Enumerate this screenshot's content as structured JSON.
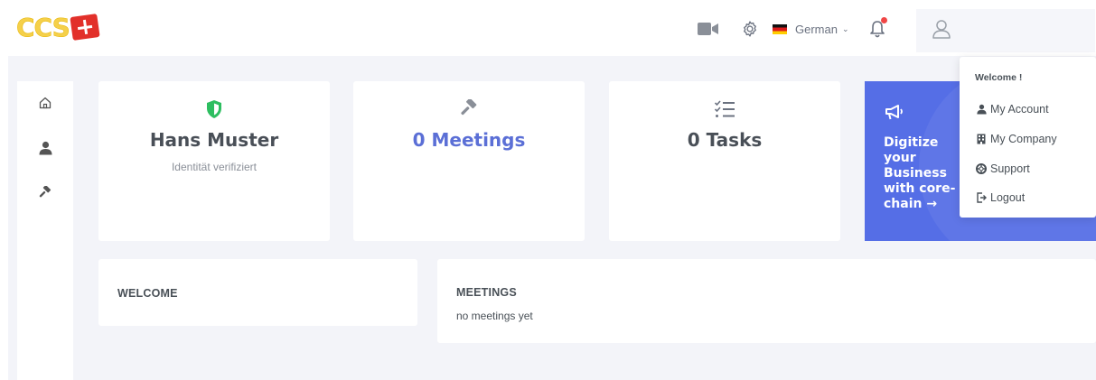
{
  "logo": {
    "text": "CCS"
  },
  "header": {
    "icons": [
      "video-icon",
      "gear-icon",
      "bell-icon",
      "user-icon"
    ],
    "language": {
      "label": "German",
      "flag": "de"
    }
  },
  "sidebar": {
    "items": [
      {
        "icon": "home-icon"
      },
      {
        "icon": "user-icon"
      },
      {
        "icon": "gavel-icon"
      }
    ]
  },
  "stats": [
    {
      "title": "Hans Muster",
      "subtitle": "Identität verifiziert",
      "icon": "shield-check-icon",
      "icon_color": "#2dbe60"
    },
    {
      "title": "0 Meetings",
      "subtitle": "",
      "icon": "gavel-icon",
      "title_color": "#5b6fd6"
    },
    {
      "title": "0 Tasks",
      "subtitle": "",
      "icon": "tasks-icon"
    }
  ],
  "promo": {
    "text": "Digitize your Business with core-chain",
    "arrow": "→",
    "icon": "megaphone-icon",
    "color": "#556ee6"
  },
  "welcome": {
    "title": "WELCOME"
  },
  "meetings": {
    "title": "MEETINGS",
    "empty_text": "no meetings yet"
  },
  "user_menu": {
    "heading": "Welcome !",
    "items": [
      {
        "label": "My Account",
        "icon": "user-icon"
      },
      {
        "label": "My Company",
        "icon": "building-icon"
      },
      {
        "label": "Support",
        "icon": "lifebuoy-icon"
      },
      {
        "label": "Logout",
        "icon": "logout-icon"
      }
    ]
  },
  "colors": {
    "accent": "#556ee6",
    "background": "#f3f4f9",
    "text": "#495057"
  }
}
